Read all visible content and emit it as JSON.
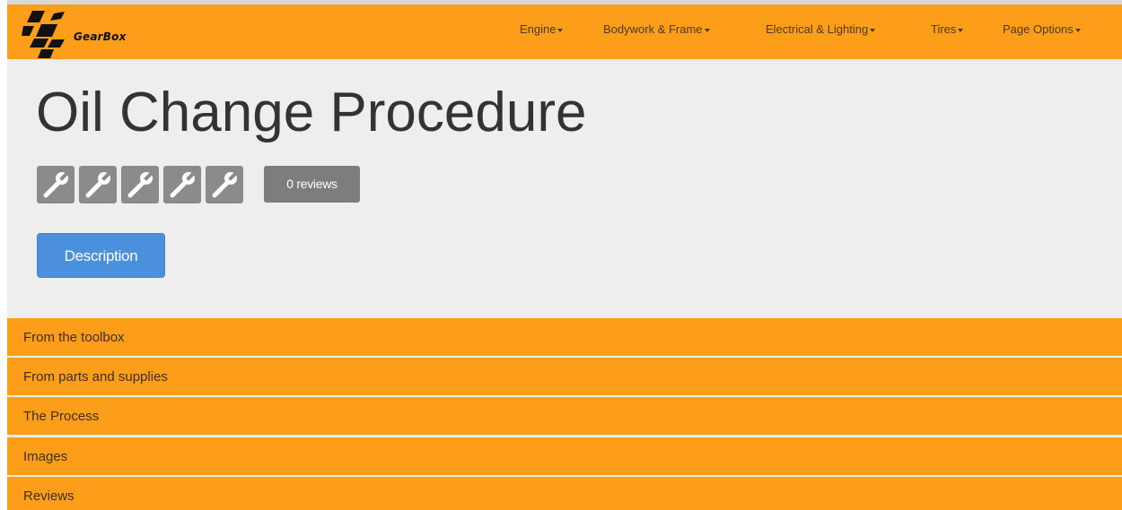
{
  "brand": {
    "name": "GearBox"
  },
  "navbar": {
    "items": [
      {
        "label": "Engine"
      },
      {
        "label": "Bodywork & Frame"
      },
      {
        "label": "Electrical & Lighting"
      },
      {
        "label": "Tires"
      },
      {
        "label": "Page Options"
      }
    ]
  },
  "page": {
    "title": "Oil Change Procedure",
    "rating": {
      "value": 0,
      "max": 5,
      "icon": "wrench-icon"
    },
    "reviews_label": "0 reviews",
    "description_button": "Description"
  },
  "sections": [
    {
      "label": "From the toolbox"
    },
    {
      "label": "From parts and supplies"
    },
    {
      "label": "The Process"
    },
    {
      "label": "Images"
    },
    {
      "label": "Reviews"
    }
  ],
  "colors": {
    "navbar": "#fd9e1a",
    "background": "#eeeeee",
    "primary_button": "#4a90dc",
    "badge": "#7d7d7d",
    "rating_icon_bg": "#8b8b8b"
  }
}
